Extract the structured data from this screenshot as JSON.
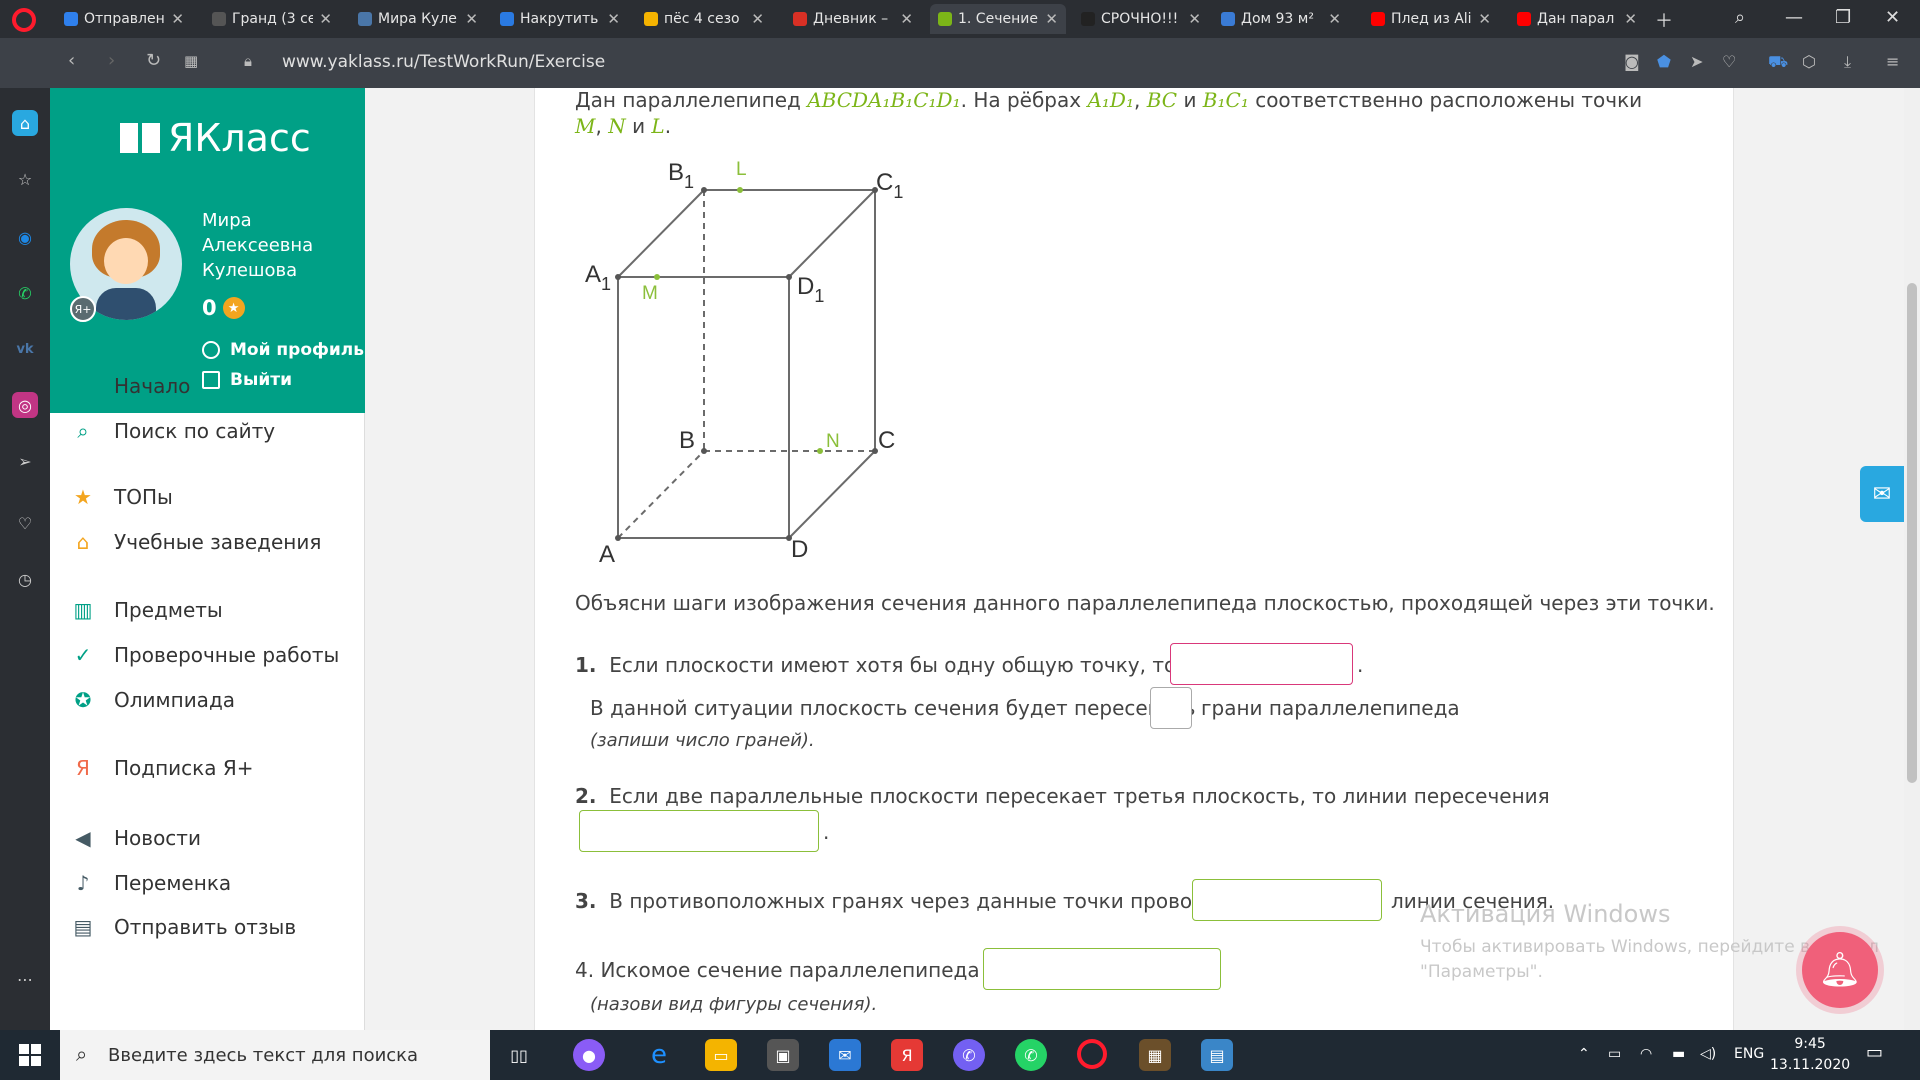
{
  "browser": {
    "tabs": [
      {
        "title": "Отправлен",
        "color": "#2f80ed"
      },
      {
        "title": "Гранд (3 се",
        "color": "#555555"
      },
      {
        "title": "Мира Куле",
        "color": "#4a76a8"
      },
      {
        "title": "Накрутить",
        "color": "#2a7ae2"
      },
      {
        "title": "пёс 4 сезо",
        "color": "#f5b300"
      },
      {
        "title": "Дневник –",
        "color": "#d93025"
      },
      {
        "title": "1. Сечение",
        "color": "#7cb518"
      },
      {
        "title": "СРОЧНО!!!",
        "color": "#222222"
      },
      {
        "title": "Дом 93 м²",
        "color": "#3a7bd5"
      },
      {
        "title": "Плед из Ali",
        "color": "#ff0000"
      },
      {
        "title": "Дан парал",
        "color": "#ff0000"
      }
    ],
    "url": "www.yaklass.ru/TestWorkRun/Exercise"
  },
  "site": {
    "logo": "ЯКласс",
    "user_name": "Мира Алексеевна Кулешова",
    "score": "0",
    "badge": "Я+",
    "profile_link": "Мой профиль",
    "logout_link": "Выйти",
    "menu": [
      {
        "label": "Начало",
        "icon": "home-icon"
      },
      {
        "label": "Поиск по сайту",
        "icon": "search-icon"
      },
      {
        "label": "ТОПы",
        "icon": "star-icon"
      },
      {
        "label": "Учебные заведения",
        "icon": "school-icon"
      },
      {
        "label": "Предметы",
        "icon": "book-icon"
      },
      {
        "label": "Проверочные работы",
        "icon": "check-icon"
      },
      {
        "label": "Олимпиада",
        "icon": "medal-icon"
      },
      {
        "label": "Подписка Я+",
        "icon": "subscription-icon"
      },
      {
        "label": "Новости",
        "icon": "megaphone-icon"
      },
      {
        "label": "Переменка",
        "icon": "bell-icon"
      },
      {
        "label": "Отправить отзыв",
        "icon": "feedback-icon"
      }
    ]
  },
  "task": {
    "intro_a": "Дан параллелепипед",
    "intro_figure": "ABCDA₁B₁C₁D₁",
    "intro_b": ". На рёбрах",
    "edge1": "A₁D₁",
    "comma": ",",
    "edge2": "BC",
    "and": "и",
    "edge3": "B₁C₁",
    "intro_c": "соответственно расположены точки",
    "pt_m": "M",
    "pt_n": "N",
    "pt_l": "L",
    "period": ".",
    "figure_labels": {
      "A": "A",
      "B": "B",
      "C": "C",
      "D": "D",
      "A1": "A",
      "B1": "B",
      "C1": "C",
      "D1": "D",
      "sub": "1",
      "M": "M",
      "N": "N",
      "L": "L"
    },
    "explain": "Объясни шаги изображения сечения данного параллелепипеда плоскостью, проходящей через эти точки.",
    "q1_num": "1.",
    "q1_text": "Если плоскости имеют хотя бы одну общую точку, то они",
    "q1_sub": "В данной ситуации плоскость сечения будет пересекать",
    "q1_sub_end": "грани параллелепипеда",
    "q1_hint": "(запиши число граней).",
    "q2_num": "2.",
    "q2_text": "Если две параллельные плоскости пересекает третья плоскость, то линии пересечения",
    "q3_num": "3.",
    "q3_text": "В противоположных гранях через данные точки проводим",
    "q3_end": "линии сечения.",
    "q4_text": "4. Искомое сечение параллелепипеда —",
    "q4_hint": "(назови вид фигуры сечения)."
  },
  "watermark": {
    "title": "Активация Windows",
    "line1": "Чтобы активировать Windows, перейдите в раздел",
    "line2": "\"Параметры\"."
  },
  "taskbar": {
    "search_placeholder": "Введите здесь текст для поиска",
    "lang": "ENG",
    "time": "9:45",
    "date": "13.11.2020"
  }
}
